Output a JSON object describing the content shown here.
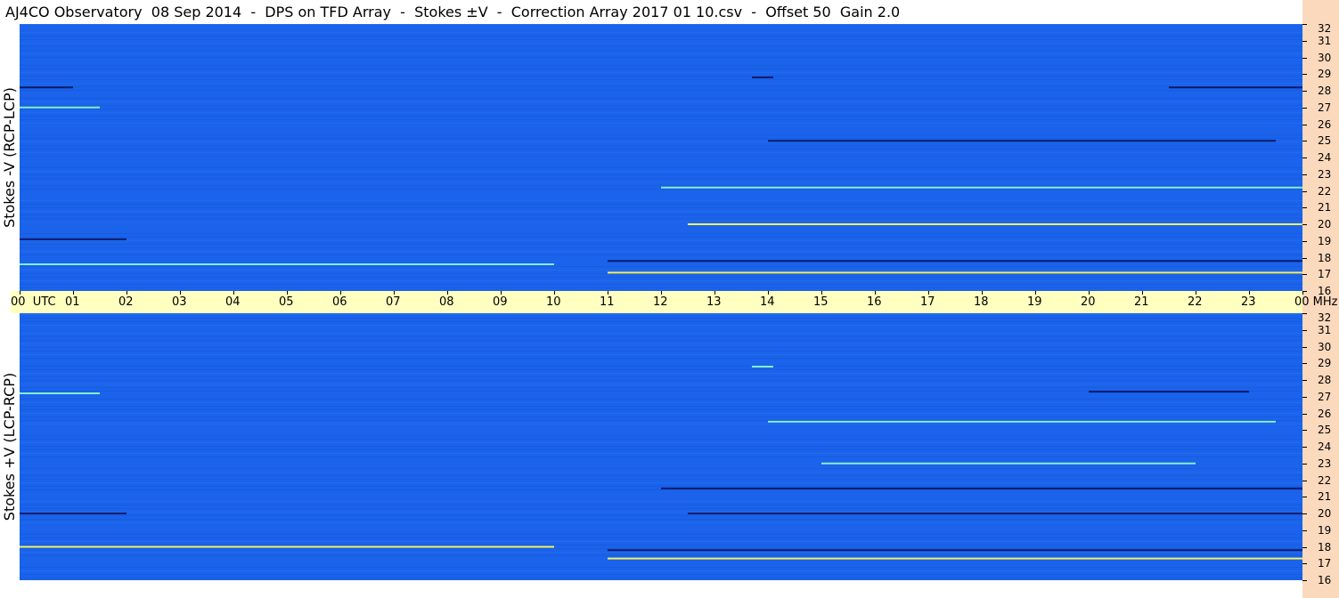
{
  "header": {
    "title": "AJ4CO Observatory  08 Sep 2014  -  DPS on TFD Array  -  Stokes ±V  -  Correction Array 2017 01 10.csv  -  Offset 50  Gain 2.0"
  },
  "panels": {
    "top": {
      "label": "Stokes -V (RCP-LCP)"
    },
    "bottom": {
      "label": "Stokes +V (LCP-RCP)"
    }
  },
  "colors": {
    "background_blue": "#1a63ea",
    "axis_band": "#ffffc0",
    "freq_strip": "#fbd9bd",
    "dark_line": "#061a6b",
    "bright_line": "#7ff0d0",
    "hot_line": "#f4f060"
  },
  "chart_data": {
    "type": "heatmap",
    "x_axis": {
      "unit": "UTC",
      "ticks": [
        "00",
        "01",
        "02",
        "03",
        "04",
        "05",
        "06",
        "07",
        "08",
        "09",
        "10",
        "11",
        "12",
        "13",
        "14",
        "15",
        "16",
        "17",
        "18",
        "19",
        "20",
        "21",
        "22",
        "23",
        "00"
      ],
      "range_hours": [
        0,
        24
      ]
    },
    "y_axis": {
      "unit": "MHz",
      "range": [
        16,
        32
      ],
      "ticks": [
        16,
        17,
        18,
        19,
        20,
        21,
        22,
        23,
        24,
        25,
        26,
        27,
        28,
        29,
        30,
        31,
        32
      ]
    },
    "panels": [
      {
        "name": "Stokes -V (RCP-LCP)",
        "features": [
          {
            "start_h": 0.0,
            "end_h": 1.5,
            "freq_mhz": 27.0,
            "kind": "bright"
          },
          {
            "start_h": 0.0,
            "end_h": 1.0,
            "freq_mhz": 28.2,
            "kind": "dark"
          },
          {
            "start_h": 13.7,
            "end_h": 14.1,
            "freq_mhz": 28.8,
            "kind": "dark"
          },
          {
            "start_h": 11.0,
            "end_h": 24.0,
            "freq_mhz": 17.8,
            "kind": "dark"
          },
          {
            "start_h": 11.0,
            "end_h": 24.0,
            "freq_mhz": 17.1,
            "kind": "hot"
          },
          {
            "start_h": 12.5,
            "end_h": 24.0,
            "freq_mhz": 20.0,
            "kind": "hot"
          },
          {
            "start_h": 12.0,
            "end_h": 24.0,
            "freq_mhz": 22.2,
            "kind": "bright"
          },
          {
            "start_h": 14.0,
            "end_h": 23.5,
            "freq_mhz": 25.0,
            "kind": "dark"
          },
          {
            "start_h": 21.5,
            "end_h": 24.0,
            "freq_mhz": 28.2,
            "kind": "dark"
          },
          {
            "start_h": 0.0,
            "end_h": 10.0,
            "freq_mhz": 17.6,
            "kind": "bright"
          },
          {
            "start_h": 0.0,
            "end_h": 2.0,
            "freq_mhz": 19.1,
            "kind": "dark"
          }
        ]
      },
      {
        "name": "Stokes +V (LCP-RCP)",
        "features": [
          {
            "start_h": 0.0,
            "end_h": 1.5,
            "freq_mhz": 27.2,
            "kind": "bright"
          },
          {
            "start_h": 13.7,
            "end_h": 14.1,
            "freq_mhz": 28.8,
            "kind": "bright"
          },
          {
            "start_h": 11.0,
            "end_h": 24.0,
            "freq_mhz": 17.8,
            "kind": "dark"
          },
          {
            "start_h": 11.0,
            "end_h": 24.0,
            "freq_mhz": 17.3,
            "kind": "hot"
          },
          {
            "start_h": 12.5,
            "end_h": 24.0,
            "freq_mhz": 20.0,
            "kind": "dark"
          },
          {
            "start_h": 12.0,
            "end_h": 24.0,
            "freq_mhz": 21.5,
            "kind": "dark"
          },
          {
            "start_h": 15.0,
            "end_h": 22.0,
            "freq_mhz": 23.0,
            "kind": "bright"
          },
          {
            "start_h": 14.0,
            "end_h": 23.5,
            "freq_mhz": 25.5,
            "kind": "bright"
          },
          {
            "start_h": 20.0,
            "end_h": 23.0,
            "freq_mhz": 27.3,
            "kind": "dark"
          },
          {
            "start_h": 0.0,
            "end_h": 10.0,
            "freq_mhz": 18.0,
            "kind": "hot"
          },
          {
            "start_h": 0.0,
            "end_h": 2.0,
            "freq_mhz": 20.0,
            "kind": "dark"
          }
        ]
      }
    ]
  }
}
